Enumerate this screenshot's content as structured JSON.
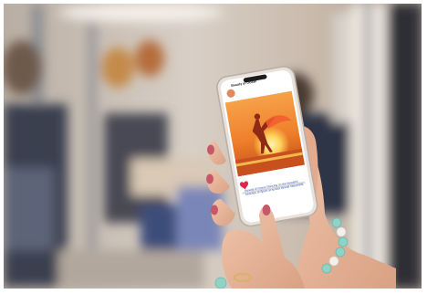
{
  "photo": {
    "subject": "hands-holding-smartphone-on-subway",
    "colors": {
      "background_blur": "#c9bfb4",
      "phone_body": "#e9e2dc",
      "post_image_sky": "#f08a2e",
      "post_image_sun": "#ffd15a",
      "skin": "#e6b39a",
      "nail_polish": "#c6586a",
      "bracelet": "#8fd3c7"
    }
  },
  "phone_post": {
    "account_name": "Beauty of Ocean",
    "caption": "Beauty of Ocean Dancing on the beautiful beaches of Spain at sunset #travel #beachlife"
  }
}
